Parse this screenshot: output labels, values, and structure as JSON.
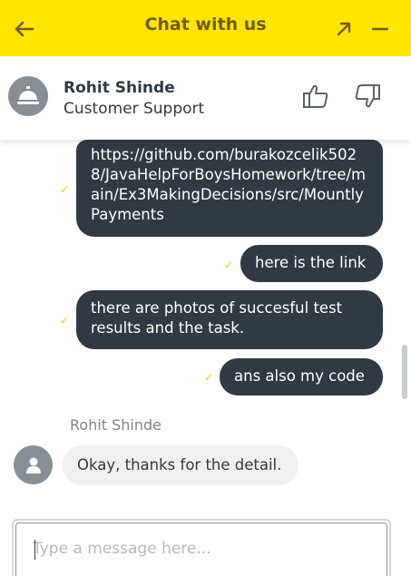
{
  "header": {
    "title": "Chat with us",
    "back_icon": "arrow-left-icon",
    "expand_icon": "arrow-up-right-icon",
    "minimize_icon": "minus-icon",
    "background_color": "#ffe500"
  },
  "agent": {
    "name": "Rohit Shinde",
    "role": "Customer Support",
    "avatar_icon": "service-bell-icon",
    "thumbs_up_icon": "thumbs-up-icon",
    "thumbs_down_icon": "thumbs-down-icon"
  },
  "messages": {
    "outgoing": [
      {
        "text": "https://github.com/burakozcelik5028/JavaHelpForBoysHomework/tree/main/Ex3MakingDecisions/src/MountlyPayments",
        "status": "✓"
      },
      {
        "text": "here is the link",
        "status": "✓"
      },
      {
        "text": "there are photos of succesful test results and the task.",
        "status": "✓"
      },
      {
        "text": "ans also my code",
        "status": "✓"
      }
    ],
    "incoming_sender": "Rohit Shinde",
    "incoming": [
      {
        "text": "Okay, thanks for the detail."
      }
    ]
  },
  "composer": {
    "placeholder": "Type a message here...",
    "value": ""
  },
  "colors": {
    "accent": "#ffe500",
    "bubble_out": "#2f3a44",
    "bubble_in": "#eef0f2",
    "check": "#f2cf00"
  }
}
